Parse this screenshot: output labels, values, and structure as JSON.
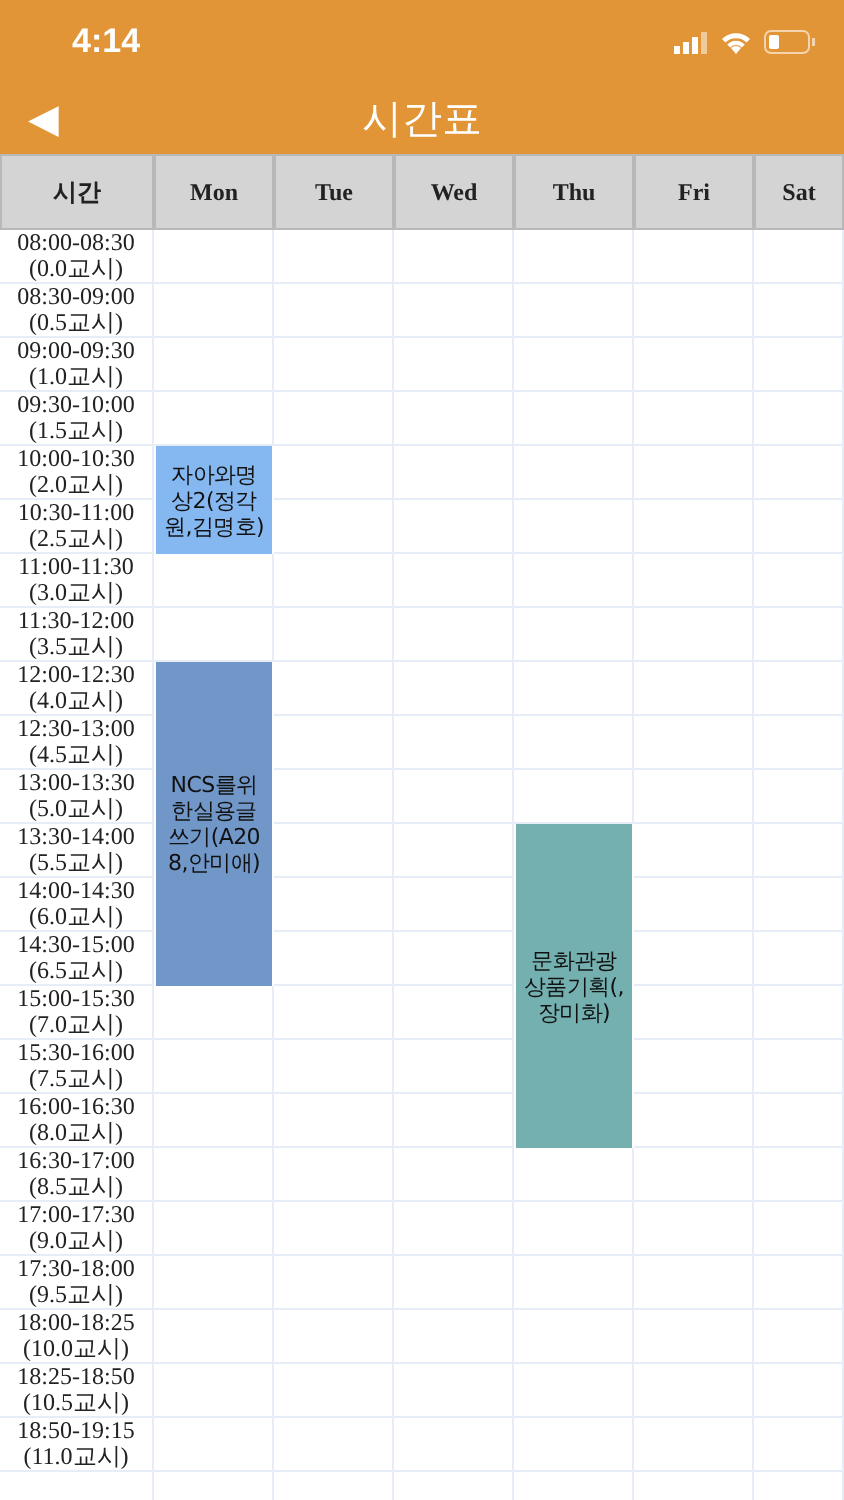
{
  "status_bar": {
    "time": "4:14"
  },
  "nav": {
    "back": "◀",
    "title": "시간표"
  },
  "table": {
    "columns": [
      "시간",
      "Mon",
      "Tue",
      "Wed",
      "Thu",
      "Fri",
      "Sat"
    ],
    "rows": [
      {
        "cells": [
          {
            "kind": "time",
            "time": "08:00-08:30",
            "period": "(0.0교시)"
          },
          {
            "kind": "free"
          },
          {
            "kind": "free"
          },
          {
            "kind": "free"
          },
          {
            "kind": "free"
          },
          {
            "kind": "free"
          },
          {
            "kind": "free"
          }
        ]
      },
      {
        "cells": [
          {
            "kind": "time",
            "time": "08:30-09:00",
            "period": "(0.5교시)"
          },
          {
            "kind": "free"
          },
          {
            "kind": "free"
          },
          {
            "kind": "free"
          },
          {
            "kind": "free"
          },
          {
            "kind": "free"
          },
          {
            "kind": "free"
          }
        ]
      },
      {
        "cells": [
          {
            "kind": "time",
            "time": "09:00-09:30",
            "period": "(1.0교시)"
          },
          {
            "kind": "free"
          },
          {
            "kind": "free"
          },
          {
            "kind": "free"
          },
          {
            "kind": "free"
          },
          {
            "kind": "free"
          },
          {
            "kind": "free"
          }
        ]
      },
      {
        "cells": [
          {
            "kind": "time",
            "time": "09:30-10:00",
            "period": "(1.5교시)"
          },
          {
            "kind": "free"
          },
          {
            "kind": "free"
          },
          {
            "kind": "free"
          },
          {
            "kind": "free"
          },
          {
            "kind": "free"
          },
          {
            "kind": "free"
          }
        ]
      },
      {
        "cells": [
          {
            "kind": "time",
            "time": "10:00-10:30",
            "period": "(2.0교시)"
          },
          {
            "kind": "course",
            "text": "자아와명상2(정각원,김명호)",
            "color": "#85b8f0",
            "rowspan": 2
          },
          {
            "kind": "free"
          },
          {
            "kind": "free"
          },
          {
            "kind": "free"
          },
          {
            "kind": "free"
          },
          {
            "kind": "free"
          }
        ]
      },
      {
        "cells": [
          {
            "kind": "time",
            "time": "10:30-11:00",
            "period": "(2.5교시)"
          },
          {
            "kind": "free"
          },
          {
            "kind": "free"
          },
          {
            "kind": "free"
          },
          {
            "kind": "free"
          },
          {
            "kind": "free"
          }
        ]
      },
      {
        "cells": [
          {
            "kind": "time",
            "time": "11:00-11:30",
            "period": "(3.0교시)"
          },
          {
            "kind": "free"
          },
          {
            "kind": "free"
          },
          {
            "kind": "free"
          },
          {
            "kind": "free"
          },
          {
            "kind": "free"
          },
          {
            "kind": "free"
          }
        ]
      },
      {
        "cells": [
          {
            "kind": "time",
            "time": "11:30-12:00",
            "period": "(3.5교시)"
          },
          {
            "kind": "free"
          },
          {
            "kind": "free"
          },
          {
            "kind": "free"
          },
          {
            "kind": "free"
          },
          {
            "kind": "free"
          },
          {
            "kind": "free"
          }
        ]
      },
      {
        "cells": [
          {
            "kind": "time",
            "time": "12:00-12:30",
            "period": "(4.0교시)"
          },
          {
            "kind": "course",
            "text": "NCS를위한실용글쓰기(A208,안미애)",
            "color": "#7097c8",
            "rowspan": 6
          },
          {
            "kind": "free"
          },
          {
            "kind": "free"
          },
          {
            "kind": "free"
          },
          {
            "kind": "free"
          },
          {
            "kind": "free"
          }
        ]
      },
      {
        "cells": [
          {
            "kind": "time",
            "time": "12:30-13:00",
            "period": "(4.5교시)"
          },
          {
            "kind": "free"
          },
          {
            "kind": "free"
          },
          {
            "kind": "free"
          },
          {
            "kind": "free"
          },
          {
            "kind": "free"
          }
        ]
      },
      {
        "cells": [
          {
            "kind": "time",
            "time": "13:00-13:30",
            "period": "(5.0교시)"
          },
          {
            "kind": "free"
          },
          {
            "kind": "free"
          },
          {
            "kind": "free"
          },
          {
            "kind": "free"
          },
          {
            "kind": "free"
          }
        ]
      },
      {
        "cells": [
          {
            "kind": "time",
            "time": "13:30-14:00",
            "period": "(5.5교시)"
          },
          {
            "kind": "free"
          },
          {
            "kind": "free"
          },
          {
            "kind": "course",
            "text": "문화관광상품기획(,장미화)",
            "color": "#74b0b0",
            "rowspan": 6
          },
          {
            "kind": "free"
          },
          {
            "kind": "free"
          }
        ]
      },
      {
        "cells": [
          {
            "kind": "time",
            "time": "14:00-14:30",
            "period": "(6.0교시)"
          },
          {
            "kind": "free"
          },
          {
            "kind": "free"
          },
          {
            "kind": "free"
          },
          {
            "kind": "free"
          }
        ]
      },
      {
        "cells": [
          {
            "kind": "time",
            "time": "14:30-15:00",
            "period": "(6.5교시)"
          },
          {
            "kind": "free"
          },
          {
            "kind": "free"
          },
          {
            "kind": "free"
          },
          {
            "kind": "free"
          }
        ]
      },
      {
        "cells": [
          {
            "kind": "time",
            "time": "15:00-15:30",
            "period": "(7.0교시)"
          },
          {
            "kind": "free"
          },
          {
            "kind": "free"
          },
          {
            "kind": "free"
          },
          {
            "kind": "free"
          },
          {
            "kind": "free"
          }
        ]
      },
      {
        "cells": [
          {
            "kind": "time",
            "time": "15:30-16:00",
            "period": "(7.5교시)"
          },
          {
            "kind": "free"
          },
          {
            "kind": "free"
          },
          {
            "kind": "free"
          },
          {
            "kind": "free"
          },
          {
            "kind": "free"
          }
        ]
      },
      {
        "cells": [
          {
            "kind": "time",
            "time": "16:00-16:30",
            "period": "(8.0교시)"
          },
          {
            "kind": "free"
          },
          {
            "kind": "free"
          },
          {
            "kind": "free"
          },
          {
            "kind": "free"
          },
          {
            "kind": "free"
          }
        ]
      },
      {
        "cells": [
          {
            "kind": "time",
            "time": "16:30-17:00",
            "period": "(8.5교시)"
          },
          {
            "kind": "free"
          },
          {
            "kind": "free"
          },
          {
            "kind": "free"
          },
          {
            "kind": "free"
          },
          {
            "kind": "free"
          },
          {
            "kind": "free"
          }
        ]
      },
      {
        "cells": [
          {
            "kind": "time",
            "time": "17:00-17:30",
            "period": "(9.0교시)"
          },
          {
            "kind": "free"
          },
          {
            "kind": "free"
          },
          {
            "kind": "free"
          },
          {
            "kind": "free"
          },
          {
            "kind": "free"
          },
          {
            "kind": "free"
          }
        ]
      },
      {
        "cells": [
          {
            "kind": "time",
            "time": "17:30-18:00",
            "period": "(9.5교시)"
          },
          {
            "kind": "free"
          },
          {
            "kind": "free"
          },
          {
            "kind": "free"
          },
          {
            "kind": "free"
          },
          {
            "kind": "free"
          },
          {
            "kind": "free"
          }
        ]
      },
      {
        "cells": [
          {
            "kind": "time",
            "time": "18:00-18:25",
            "period": "(10.0교시)"
          },
          {
            "kind": "free"
          },
          {
            "kind": "free"
          },
          {
            "kind": "free"
          },
          {
            "kind": "free"
          },
          {
            "kind": "free"
          },
          {
            "kind": "free"
          }
        ]
      },
      {
        "cells": [
          {
            "kind": "time",
            "time": "18:25-18:50",
            "period": "(10.5교시)"
          },
          {
            "kind": "free"
          },
          {
            "kind": "free"
          },
          {
            "kind": "free"
          },
          {
            "kind": "free"
          },
          {
            "kind": "free"
          },
          {
            "kind": "free"
          }
        ]
      },
      {
        "cells": [
          {
            "kind": "time",
            "time": "18:50-19:15",
            "period": "(11.0교시)"
          },
          {
            "kind": "free"
          },
          {
            "kind": "free"
          },
          {
            "kind": "free"
          },
          {
            "kind": "free"
          },
          {
            "kind": "free"
          },
          {
            "kind": "free"
          }
        ]
      }
    ]
  }
}
